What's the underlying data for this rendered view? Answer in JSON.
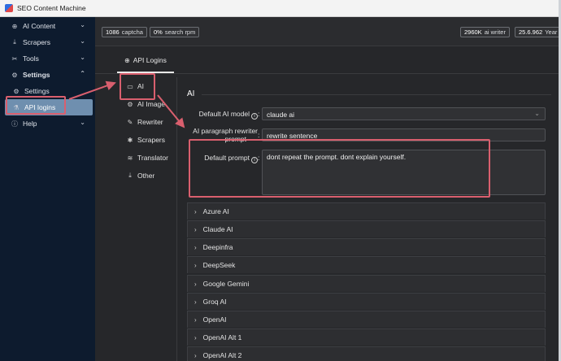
{
  "window": {
    "title": "SEO Content Machine"
  },
  "sidebar": {
    "items": [
      {
        "label": "AI Content",
        "icon": "globe-icon",
        "chevron": "⌄"
      },
      {
        "label": "Scrapers",
        "icon": "download-icon",
        "chevron": "⌄"
      },
      {
        "label": "Tools",
        "icon": "tools-icon",
        "chevron": "⌄"
      },
      {
        "label": "Settings",
        "icon": "gear-icon",
        "chevron": "⌃"
      },
      {
        "label": "Settings",
        "icon": "gear-icon"
      },
      {
        "label": "API logins",
        "icon": "flask-icon"
      },
      {
        "label": "Help",
        "icon": "help-icon",
        "chevron": "⌄"
      }
    ]
  },
  "topbar": {
    "pills": [
      {
        "num": "1086",
        "label": "captcha"
      },
      {
        "num": "0%",
        "label": "search rpm"
      },
      {
        "num": "2960K",
        "label": "ai writer"
      },
      {
        "num": "25.6.962",
        "label": "Year"
      }
    ]
  },
  "tabs": {
    "api_logins": "API Logins"
  },
  "subnav": {
    "items": [
      "AI",
      "AI Image",
      "Rewriter",
      "Scrapers",
      "Translator",
      "Other"
    ]
  },
  "section": {
    "title": "AI"
  },
  "form": {
    "default_ai_model": {
      "label": "Default AI model",
      "value": "claude ai"
    },
    "rewriter_prompt": {
      "label_line1": "AI paragraph rewriter",
      "label_line2": "prompt",
      "value": "rewrite sentence"
    },
    "default_prompt": {
      "label": "Default prompt",
      "value": "dont repeat the prompt. dont explain yourself."
    }
  },
  "providers": [
    "Azure AI",
    "Claude AI",
    "Deepinfra",
    "DeepSeek",
    "Google Gemini",
    "Groq AI",
    "OpenAI",
    "OpenAI Alt 1",
    "OpenAI Alt 2"
  ],
  "colors": {
    "sidebar_bg": "#0d1b2e",
    "active_item": "#6f8faf",
    "highlight": "#d95f6e",
    "panel_bg": "#26272a"
  }
}
